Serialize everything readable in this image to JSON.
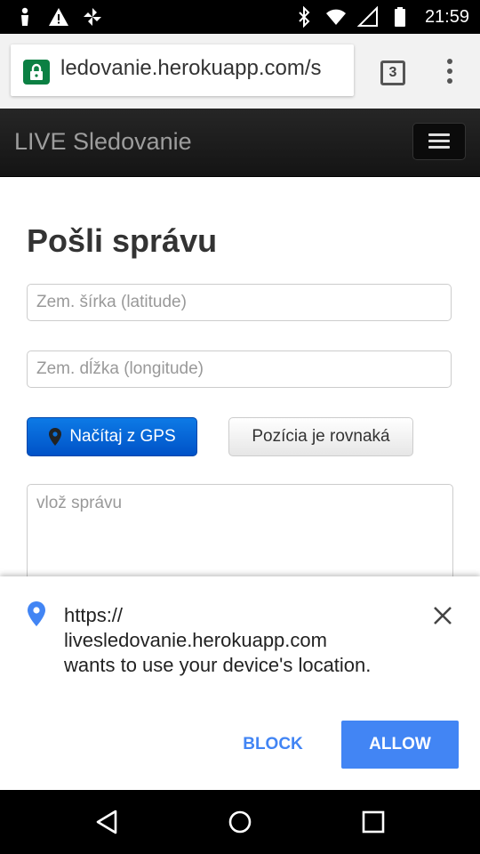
{
  "status_bar": {
    "time": "21:59",
    "left_icons": [
      "person-icon",
      "warning-icon",
      "pinwheel-icon"
    ],
    "right_icons": [
      "bluetooth-icon",
      "wifi-icon",
      "signal-icon",
      "battery-icon"
    ]
  },
  "browser": {
    "url": "ledovanie.herokuapp.com/s",
    "tab_count": "3",
    "lock_color": "#0b8043"
  },
  "navbar": {
    "brand": "LIVE Sledovanie"
  },
  "form": {
    "title": "Pošli správu",
    "latitude_placeholder": "Zem. šírka (latitude)",
    "longitude_placeholder": "Zem. dĺžka (longitude)",
    "gps_button": "Načítaj z GPS",
    "same_position_button": "Pozícia je rovnaká",
    "message_placeholder": "vlož správu"
  },
  "permission_dialog": {
    "line1": "https://",
    "line2": "livesledovanie.herokuapp.com",
    "line3": "wants to use your device's location.",
    "block_label": "BLOCK",
    "allow_label": "ALLOW",
    "accent": "#4285f4"
  },
  "system_nav": [
    "back-icon",
    "home-icon",
    "recents-icon"
  ]
}
